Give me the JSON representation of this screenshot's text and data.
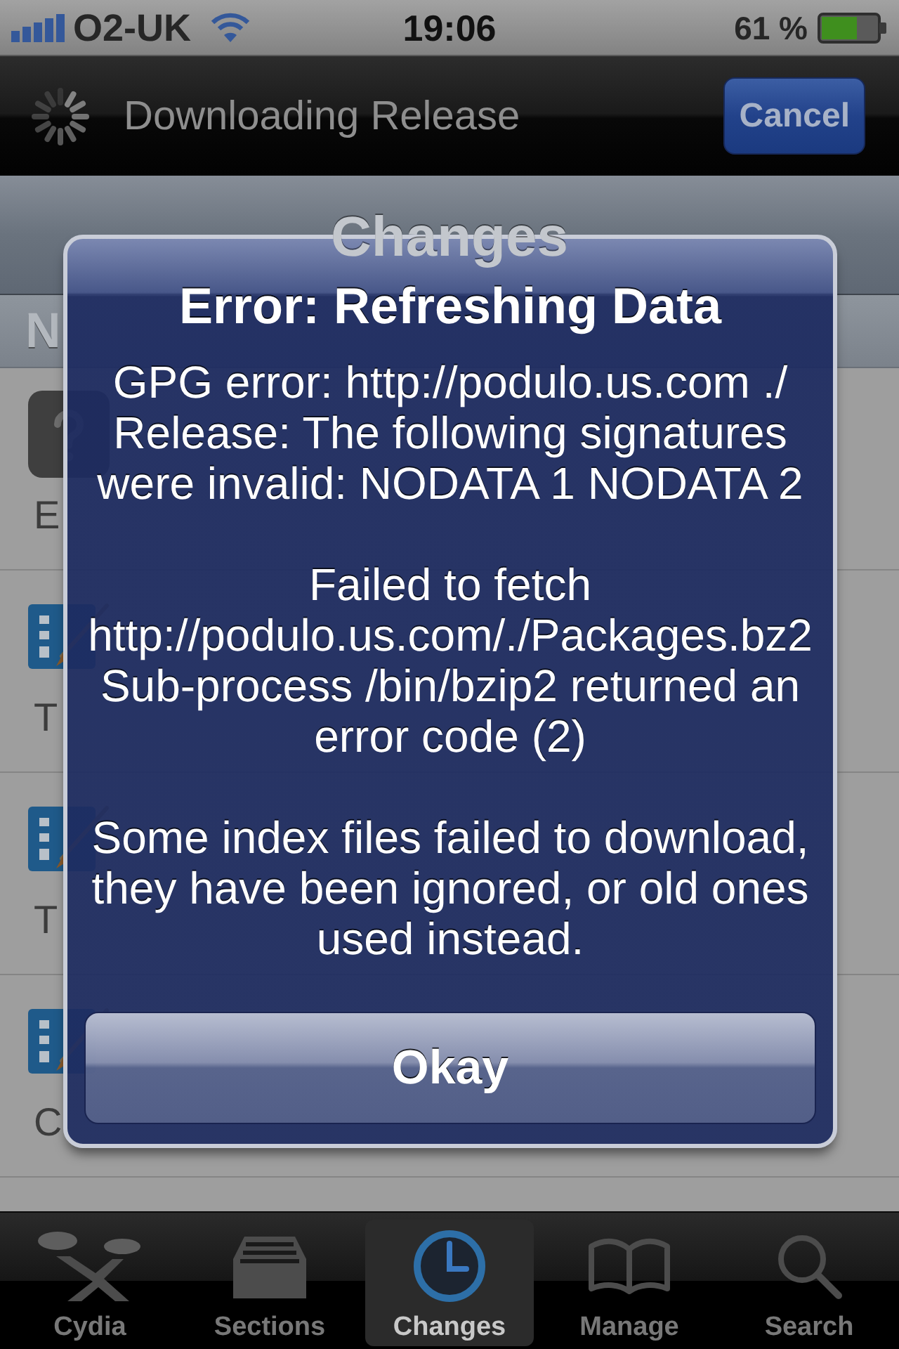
{
  "status_bar": {
    "carrier": "O2-UK",
    "time": "19:06",
    "battery": "61 %"
  },
  "progress_bar": {
    "title": "Downloading Release",
    "button": "Cancel"
  },
  "nav_bar": {
    "title": "Changes"
  },
  "section_header": "N",
  "packages": [
    {
      "kind": "app",
      "description": "E"
    },
    {
      "kind": "theme",
      "description": "T"
    },
    {
      "kind": "theme",
      "description": "T"
    },
    {
      "kind": "theme",
      "description": "C"
    }
  ],
  "alert": {
    "title": "Error: Refreshing Data",
    "paragraphs": [
      "GPG error: http://podulo.us.com ./ Release: The following signatures were invalid: NODATA 1 NODATA 2",
      "Failed to fetch http://podulo.us.com/./Packages.bz2  Sub-process /bin/bzip2 returned an error code (2)",
      "Some index files failed to download, they have been ignored, or old ones used instead."
    ],
    "button": "Okay"
  },
  "tab_bar": [
    {
      "label": "Cydia",
      "selected": false
    },
    {
      "label": "Sections",
      "selected": false
    },
    {
      "label": "Changes",
      "selected": true
    },
    {
      "label": "Manage",
      "selected": false
    },
    {
      "label": "Search",
      "selected": false
    }
  ]
}
